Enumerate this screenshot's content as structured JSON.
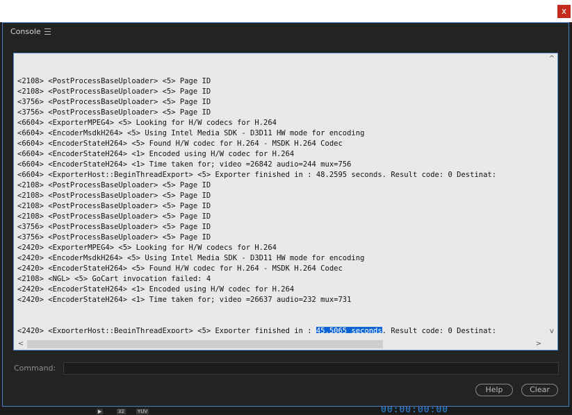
{
  "window": {
    "close_label": "x"
  },
  "dialog": {
    "title": "Console",
    "command_label": "Command:",
    "command_value": "",
    "help_label": "Help",
    "clear_label": "Clear"
  },
  "background": {
    "badges": [
      "▶",
      "32",
      "YUV"
    ],
    "timecode": "00:00:00:00"
  },
  "scroll": {
    "left": "<",
    "right": ">",
    "up": "^",
    "down": "v"
  },
  "log": {
    "lines": [
      "<2108> <PostProcessBaseUploader> <5> Page ID",
      "<2108> <PostProcessBaseUploader> <5> Page ID",
      "<3756> <PostProcessBaseUploader> <5> Page ID",
      "<3756> <PostProcessBaseUploader> <5> Page ID",
      "<6604> <ExporterMPEG4> <5> Looking for H/W codecs for H.264",
      "<6604> <EncoderMsdkH264> <5> Using Intel Media SDK - D3D11 HW mode for encoding",
      "<6604> <EncoderStateH264> <5> Found H/W codec for H.264 - MSDK H.264 Codec",
      "<6604> <EncoderStateH264> <1> Encoded using H/W codec for H.264",
      "<6604> <EncoderStateH264> <1> Time taken for; video =26842 audio=244 mux=756",
      "<6604> <ExporterHost::BeginThreadExport> <5> Exporter finished in : 48.2595 seconds. Result code: 0 Destinat:",
      "<2108> <PostProcessBaseUploader> <5> Page ID",
      "<2108> <PostProcessBaseUploader> <5> Page ID",
      "<2108> <PostProcessBaseUploader> <5> Page ID",
      "<2108> <PostProcessBaseUploader> <5> Page ID",
      "<3756> <PostProcessBaseUploader> <5> Page ID",
      "<3756> <PostProcessBaseUploader> <5> Page ID",
      "<2420> <ExporterMPEG4> <5> Looking for H/W codecs for H.264",
      "<2420> <EncoderMsdkH264> <5> Using Intel Media SDK - D3D11 HW mode for encoding",
      "<2420> <EncoderStateH264> <5> Found H/W codec for H.264 - MSDK H.264 Codec",
      "<2108> <NGL> <5> GoCart invocation failed: 4",
      "<2420> <EncoderStateH264> <1> Encoded using H/W codec for H.264",
      "<2420> <EncoderStateH264> <1> Time taken for; video =26637 audio=232 mux=731"
    ],
    "last_line_prefix": "<2420> <ExporterHost::BeginThreadExport> <5> Exporter finished in : ",
    "last_line_selected": "45.5065 seconds",
    "last_line_suffix": ". Result code: 0 Destinat:"
  },
  "colors": {
    "dialog_bg": "#232323",
    "log_bg": "#e9e9e9",
    "accent_border": "#5a8fd4",
    "selection": "#0a64d6",
    "close_button": "#c42b1c"
  },
  "icons": {
    "menu": "hamburger-icon",
    "close": "close-icon",
    "scroll_left": "chevron-left-icon",
    "scroll_right": "chevron-right-icon",
    "scroll_up": "chevron-up-icon",
    "scroll_down": "chevron-down-icon"
  }
}
